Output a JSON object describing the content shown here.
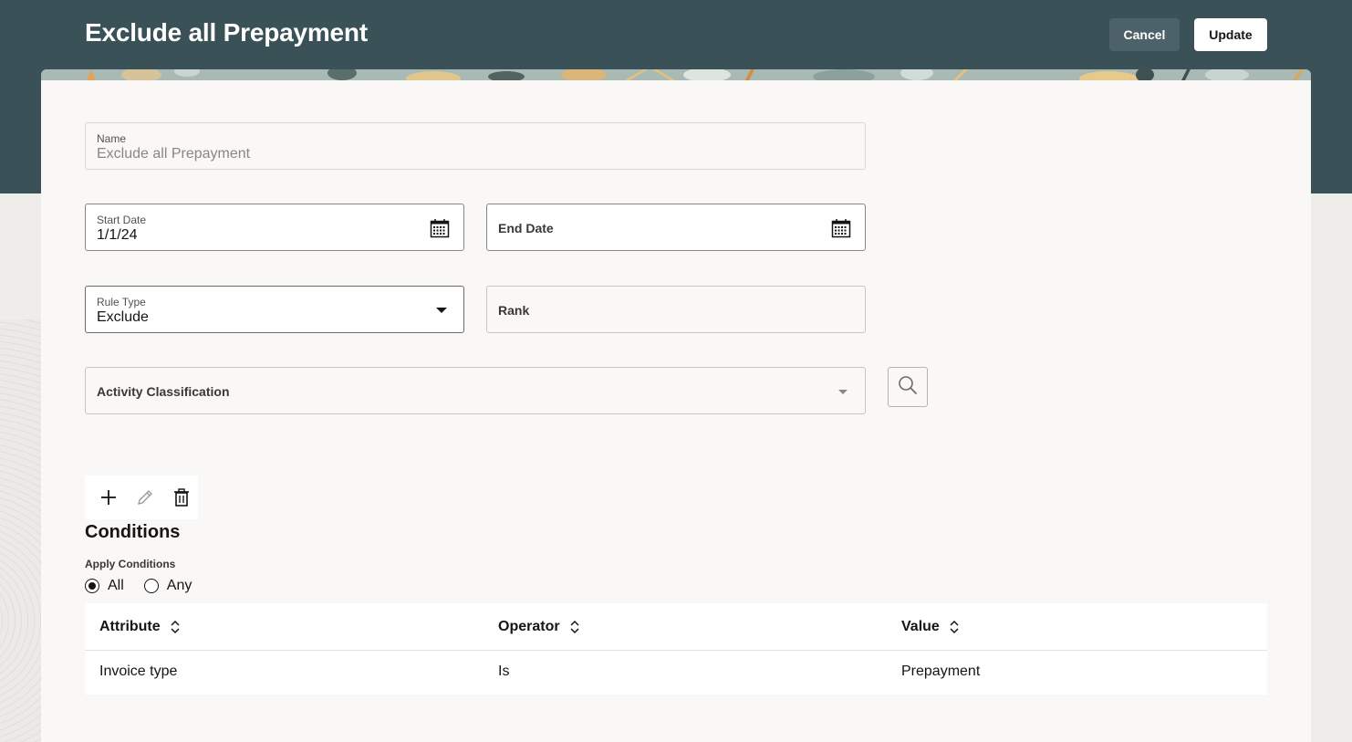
{
  "header": {
    "title": "Exclude all Prepayment",
    "cancel_label": "Cancel",
    "update_label": "Update"
  },
  "form": {
    "name": {
      "label": "Name",
      "value": "Exclude all Prepayment"
    },
    "start_date": {
      "label": "Start Date",
      "value": "1/1/24"
    },
    "end_date": {
      "label": "End Date",
      "value": ""
    },
    "rule_type": {
      "label": "Rule Type",
      "value": "Exclude"
    },
    "rank": {
      "label": "Rank",
      "value": ""
    },
    "activity_classification": {
      "label": "Activity Classification",
      "value": ""
    }
  },
  "conditions": {
    "title": "Conditions",
    "apply_label": "Apply Conditions",
    "options": [
      "All",
      "Any"
    ],
    "selected": "All",
    "columns": [
      "Attribute",
      "Operator",
      "Value"
    ],
    "rows": [
      {
        "attribute": "Invoice type",
        "operator": "Is",
        "value": "Prepayment"
      }
    ]
  },
  "icons": {
    "start_date": "calendar-icon",
    "end_date": "calendar-icon",
    "rule_type": "chevron-down-icon",
    "activity": "chevron-down-icon",
    "search": "search-icon",
    "add": "plus-icon",
    "edit": "pencil-icon",
    "delete": "trash-icon",
    "sort": "sort-icon"
  },
  "colors": {
    "header_bg": "#3a5157",
    "card_bg": "#f9f8f6",
    "accent": "#161513"
  }
}
